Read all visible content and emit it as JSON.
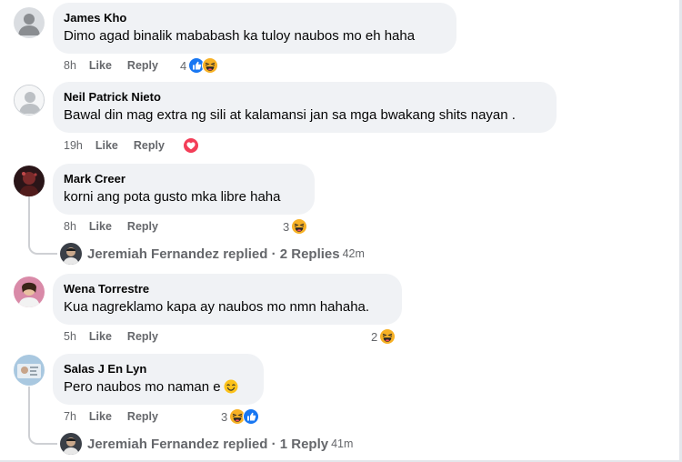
{
  "comments": [
    {
      "author": "James Kho",
      "text": "Dimo agad binalik mababash ka tuloy naubos mo eh haha",
      "time": "8h",
      "like": "Like",
      "reply": "Reply",
      "reaction_count": "4",
      "reactions": [
        "like-icon",
        "haha-icon"
      ]
    },
    {
      "author": "Neil Patrick Nieto",
      "text": "Bawal din mag extra ng sili at kalamansi jan sa mga bwakang shits nayan .",
      "time": "19h",
      "like": "Like",
      "reply": "Reply",
      "reaction_count": "",
      "reactions": [
        "love-icon"
      ]
    },
    {
      "author": "Mark Creer",
      "text": "korni ang pota gusto mka libre haha",
      "time": "8h",
      "like": "Like",
      "reply": "Reply",
      "reaction_count": "3",
      "reactions": [
        "haha-icon"
      ],
      "replies": {
        "text": "Jeremiah Fernandez replied · 2 Replies",
        "time": "42m"
      }
    },
    {
      "author": "Wena Torrestre",
      "text": "Kua nagreklamo kapa ay naubos mo nmn hahaha.",
      "time": "5h",
      "like": "Like",
      "reply": "Reply",
      "reaction_count": "2",
      "reactions": [
        "haha-icon"
      ]
    },
    {
      "author": "Salas J En Lyn",
      "text": "Pero naubos mo naman e",
      "time": "7h",
      "like": "Like",
      "reply": "Reply",
      "reaction_count": "3",
      "reactions": [
        "haha-icon",
        "like-icon"
      ],
      "replies": {
        "text": "Jeremiah Fernandez replied · 1 Reply",
        "time": "41m"
      }
    }
  ],
  "colors": {
    "bubble": "#f0f2f5",
    "secondary_text": "#65676b",
    "like_blue": "#1877f2",
    "love_red": "#f33e58",
    "haha_yellow": "#f7b125"
  }
}
